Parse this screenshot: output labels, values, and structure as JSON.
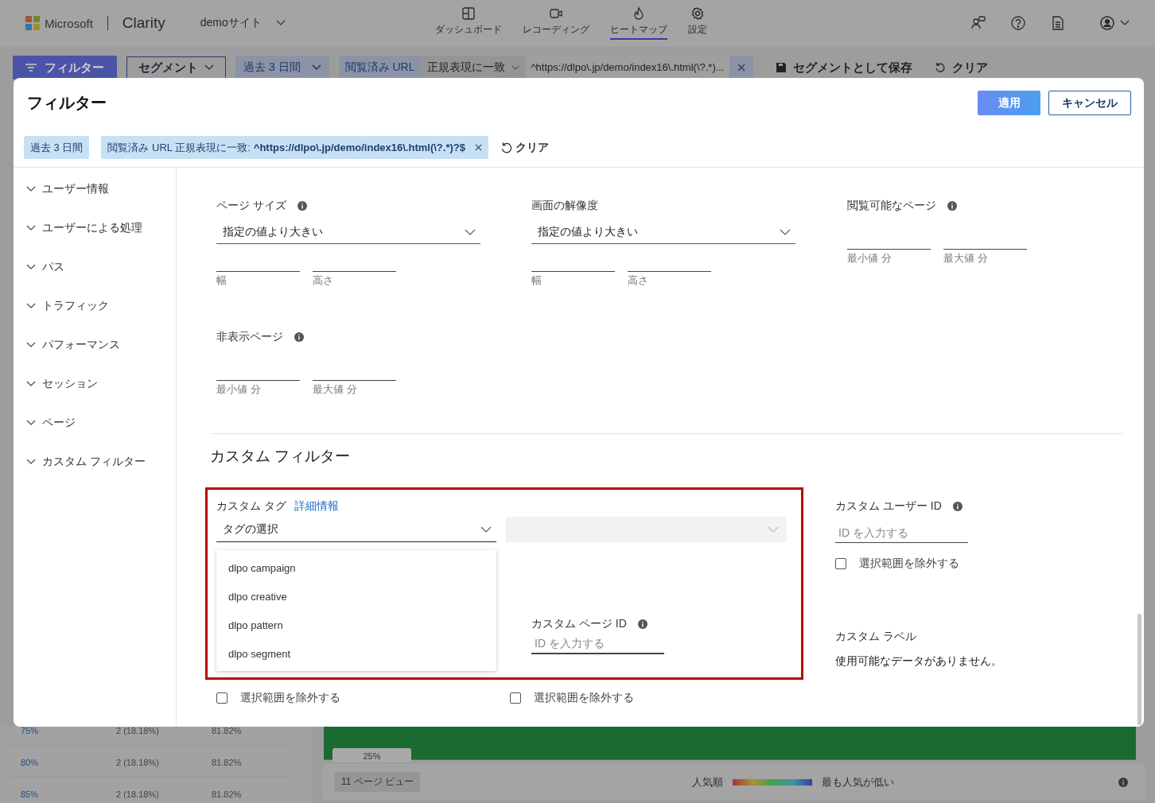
{
  "topbar": {
    "brand": "Microsoft",
    "product": "Clarity",
    "site": "demoサイト",
    "nav": [
      {
        "label": "ダッシュボード",
        "selected": false
      },
      {
        "label": "レコーディング",
        "selected": false
      },
      {
        "label": "ヒートマップ",
        "selected": true
      },
      {
        "label": "設定",
        "selected": false
      }
    ]
  },
  "filter_bar": {
    "filter_button": "フィルター",
    "segment_button": "セグメント",
    "date_range": "過去 3 日間",
    "url_filter": {
      "field": "閲覧済み URL",
      "operator": "正規表現に一致",
      "value": "^https://dlpo\\.jp/demo/index16\\.html(\\?.*)..."
    },
    "save_button": "セグメントとして保存",
    "clear_button": "クリア"
  },
  "dialog": {
    "title": "フィルター",
    "apply_button": "適用",
    "cancel_button": "キャンセル",
    "chips": [
      {
        "label": "過去 3 日間",
        "removable": false
      },
      {
        "label": "閲覧済み URL 正規表現に一致:",
        "value": "^https://dlpo\\.jp/demo/index16\\.html(\\?.*)?$",
        "removable": true
      }
    ],
    "clear_button": "クリア",
    "sidebar": [
      {
        "label": "ユーザー情報",
        "expanded": false
      },
      {
        "label": "ユーザーによる処理",
        "expanded": false
      },
      {
        "label": "パス",
        "expanded": false
      },
      {
        "label": "トラフィック",
        "expanded": false
      },
      {
        "label": "パフォーマンス",
        "expanded": false
      },
      {
        "label": "セッション",
        "expanded": false
      },
      {
        "label": "ページ",
        "expanded": false
      },
      {
        "label": "カスタム フィルター",
        "expanded": false
      }
    ],
    "page_filters": [
      {
        "kind": "dropdown_pair",
        "label": "ページ サイズ",
        "info": true,
        "dropdown": "指定の値より大きい",
        "captions": [
          "幅",
          "高さ"
        ]
      },
      {
        "kind": "dropdown_pair",
        "label": "画面の解像度",
        "info": false,
        "dropdown": "指定の値より大きい",
        "captions": [
          "幅",
          "高さ"
        ]
      },
      {
        "kind": "range",
        "label": "閲覧可能なページ",
        "info": true,
        "captions": [
          "最小値 分",
          "最大値 分"
        ]
      },
      {
        "kind": "range",
        "label": "非表示ページ",
        "info": true,
        "captions": [
          "最小値 分",
          "最大値 分"
        ]
      }
    ],
    "custom_heading": "カスタム フィルター",
    "custom_tag": {
      "label": "カスタム タグ",
      "link": "詳細情報",
      "dropdown": "タグの選択",
      "expanded": true,
      "options": [
        "dlpo campaign",
        "dlpo creative",
        "dlpo pattern",
        "dlpo segment"
      ],
      "exclude": {
        "label": "選択範囲を除外する",
        "checked": false
      }
    },
    "custom_page_id": {
      "label": "カスタム ページ ID",
      "placeholder": "ID を入力する",
      "exclude": {
        "label": "選択範囲を除外する",
        "checked": false
      }
    },
    "custom_user_id": {
      "label": "カスタム ユーザー ID",
      "placeholder": "ID を入力する",
      "exclude": {
        "label": "選択範囲を除外する",
        "checked": false
      }
    },
    "custom_label": {
      "label": "カスタム ラベル",
      "message": "使用可能なデータがありません。"
    }
  },
  "background": {
    "scroll_rows": [
      {
        "depth": "75%",
        "visitors": "2 (18.18%)",
        "dropoff": "81.82%"
      },
      {
        "depth": "80%",
        "visitors": "2 (18.18%)",
        "dropoff": "81.82%"
      },
      {
        "depth": "85%",
        "visitors": "2 (18.18%)",
        "dropoff": "81.82%"
      }
    ],
    "fold_marker": "25%",
    "page_views": "11 ページ ビュー",
    "legend_high": "人気順",
    "legend_low": "最も人気が低い"
  }
}
